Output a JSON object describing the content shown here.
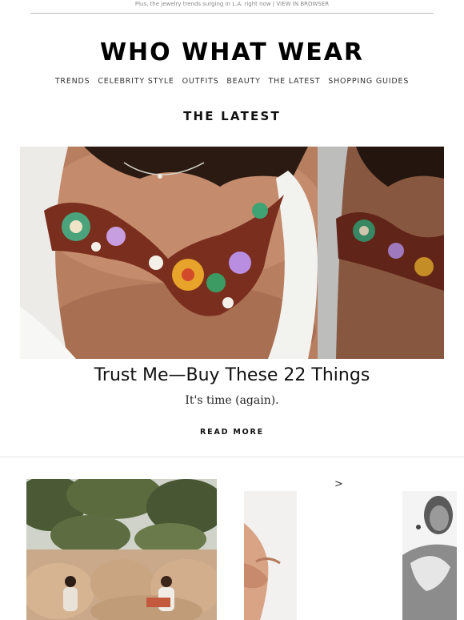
{
  "preheader": {
    "text": "Plus, the jewelry trends surging in L.A. right now",
    "separator": " | ",
    "link": "VIEW IN BROWSER"
  },
  "brand": {
    "logo": "WHO WHAT WEAR"
  },
  "nav": {
    "items": [
      "TRENDS",
      "CELEBRITY STYLE",
      "OUTFITS",
      "BEAUTY",
      "THE LATEST",
      "SHOPPING GUIDES"
    ]
  },
  "section": {
    "title": "THE LATEST"
  },
  "feature": {
    "headline": "Trust Me—Buy These 22 Things",
    "subhead": "It's time (again).",
    "cta": "READ MORE"
  },
  "carousel": {
    "next_arrow": ">"
  }
}
